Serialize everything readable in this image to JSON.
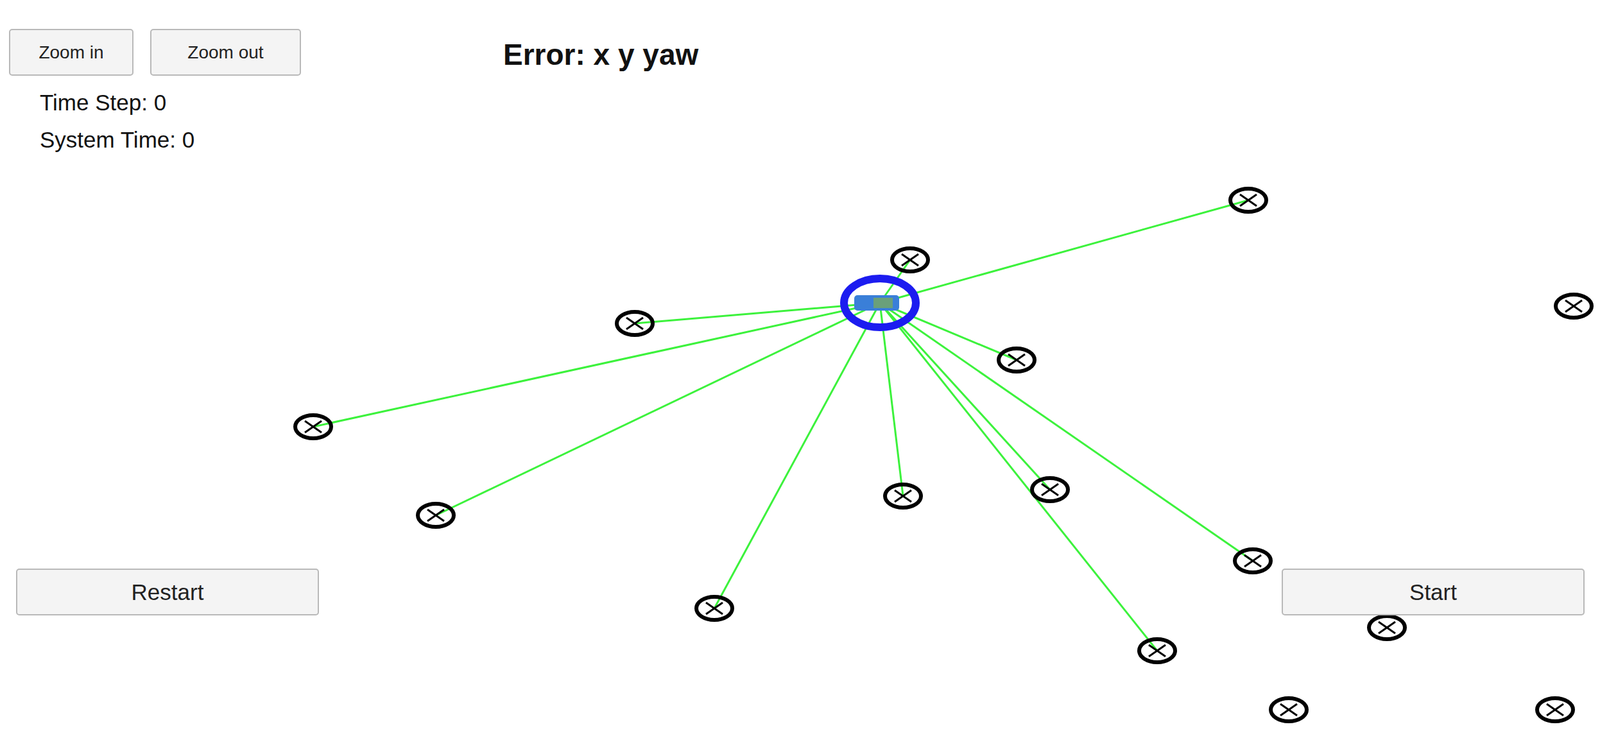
{
  "window": {
    "title": "Error: x y yaw"
  },
  "zoom_buttons": [
    "Zoom in",
    "Zoom out"
  ],
  "status": [
    {
      "label": "Time Step: 0"
    },
    {
      "label": "System Time: 0"
    }
  ],
  "control_buttons": [
    "Restart",
    "Start"
  ],
  "landmarks": [
    {
      "observed": true
    },
    {
      "observed": true
    },
    {
      "observed": false
    },
    {
      "observed": true
    },
    {
      "observed": true
    },
    {
      "observed": true
    },
    {
      "observed": true
    },
    {
      "observed": true
    },
    {
      "observed": true
    },
    {
      "observed": true
    },
    {
      "observed": true
    },
    {
      "observed": true
    },
    {
      "observed": false
    },
    {
      "observed": false
    },
    {
      "observed": false
    }
  ]
}
